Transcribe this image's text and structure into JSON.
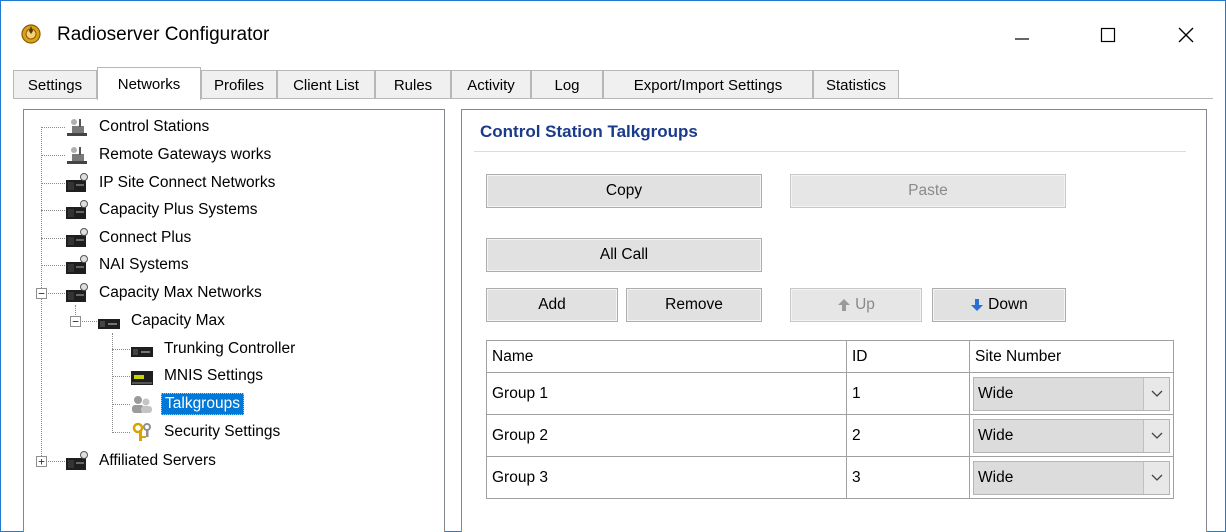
{
  "window": {
    "title": "Radioserver Configurator"
  },
  "tabs": [
    {
      "label": "Settings"
    },
    {
      "label": "Networks"
    },
    {
      "label": "Profiles"
    },
    {
      "label": "Client List"
    },
    {
      "label": "Rules"
    },
    {
      "label": "Activity"
    },
    {
      "label": "Log"
    },
    {
      "label": "Export/Import Settings"
    },
    {
      "label": "Statistics"
    }
  ],
  "active_tab": "Networks",
  "tree": {
    "items": [
      {
        "label": "Control Stations",
        "icon": "radio-tower-icon"
      },
      {
        "label": "Remote Gateways  works",
        "icon": "radio-tower-icon"
      },
      {
        "label": "IP Site Connect Networks",
        "icon": "network-server-icon"
      },
      {
        "label": "Capacity Plus Systems",
        "icon": "network-server-icon"
      },
      {
        "label": "Connect Plus",
        "icon": "network-server-icon"
      },
      {
        "label": "NAI Systems",
        "icon": "network-server-icon"
      },
      {
        "label": "Capacity Max Networks",
        "icon": "network-server-icon",
        "expander": "−"
      },
      {
        "label": "Capacity Max",
        "icon": "server-icon",
        "expander": "−"
      },
      {
        "label": "Trunking Controller",
        "icon": "server-icon"
      },
      {
        "label": "MNIS Settings",
        "icon": "terminal-icon"
      },
      {
        "label": "Talkgroups",
        "icon": "users-icon",
        "selected": true
      },
      {
        "label": "Security Settings",
        "icon": "keys-icon"
      },
      {
        "label": "Affiliated Servers",
        "icon": "network-server-icon",
        "expander": "+"
      }
    ]
  },
  "panel": {
    "title": "Control Station Talkgroups",
    "buttons": {
      "copy": "Copy",
      "paste": "Paste",
      "all_call": "All Call",
      "add": "Add",
      "remove": "Remove",
      "up": "Up",
      "down": "Down"
    },
    "table": {
      "columns": [
        "Name",
        "ID",
        "Site Number"
      ],
      "rows": [
        {
          "name": "Group 1",
          "id": "1",
          "site": "Wide"
        },
        {
          "name": "Group 2",
          "id": "2",
          "site": "Wide"
        },
        {
          "name": "Group 3",
          "id": "3",
          "site": "Wide"
        }
      ]
    }
  },
  "colors": {
    "selection": "#0078d7",
    "group_title": "#1a3a8a",
    "window_border": "#1f7ad0"
  }
}
